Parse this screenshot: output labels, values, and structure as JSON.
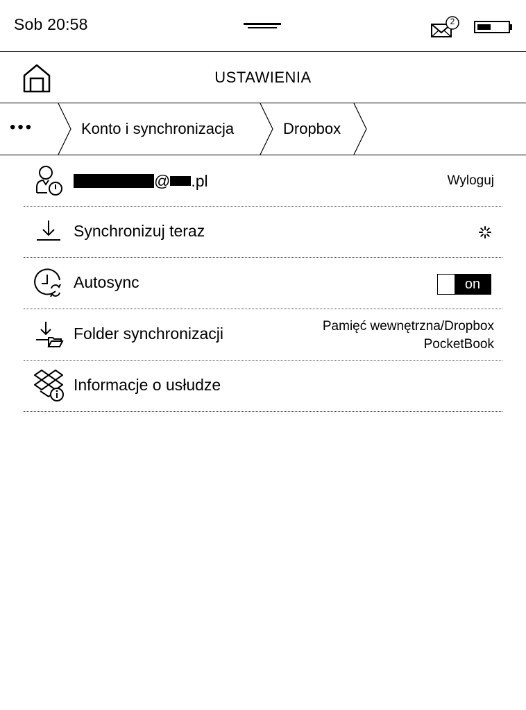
{
  "status": {
    "time": "Sob 20:58",
    "mail_count": "2",
    "battery_level": 0.45
  },
  "header": {
    "title": "USTAWIENIA"
  },
  "breadcrumb": {
    "more": "•••",
    "items": [
      {
        "label": "Konto i synchronizacja"
      },
      {
        "label": "Dropbox"
      }
    ]
  },
  "account": {
    "email_at": "@",
    "email_domain": ".pl",
    "logout_label": "Wyloguj"
  },
  "sync_now": {
    "label": "Synchronizuj teraz"
  },
  "autosync": {
    "label": "Autosync",
    "state": "on"
  },
  "sync_folder": {
    "label": "Folder synchronizacji",
    "value_line1": "Pamięć wewnętrzna/Dropbox",
    "value_line2": "PocketBook"
  },
  "service_info": {
    "label": "Informacje o usłudze"
  },
  "icons": {
    "home": "home-icon",
    "mail": "mail-icon",
    "battery": "battery-icon",
    "account": "user-power-icon",
    "sync": "download-icon",
    "autosync": "clock-sync-icon",
    "folder": "download-folder-icon",
    "info": "dropbox-info-icon"
  }
}
